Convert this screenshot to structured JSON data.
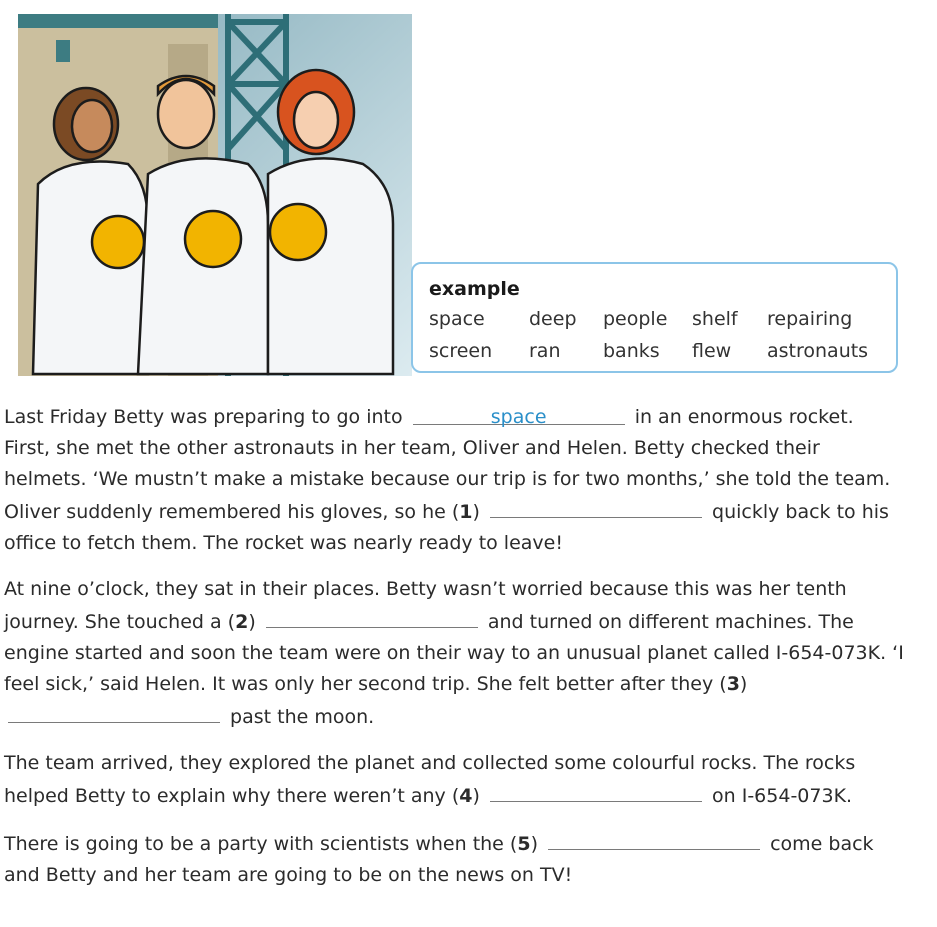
{
  "colors": {
    "box_border": "#8cc5e8",
    "answer_blue": "#2a8fc9",
    "text": "#2b2b2b"
  },
  "illustration": {
    "description_icon": "three-astronauts-illustration"
  },
  "word_box": {
    "title": "example",
    "row1": [
      "space",
      "deep",
      "people",
      "shelf",
      "repairing"
    ],
    "row2": [
      "screen",
      "ran",
      "banks",
      "flew",
      "astronauts"
    ]
  },
  "passage": {
    "p1": {
      "a": "Last Friday Betty was preparing to go into",
      "example_answer": "space",
      "b": "in an enormous rocket. First, she met the other astronauts in her team, Oliver and Helen. Betty checked their helmets. ‘We mustn’t make a mistake because our trip is for two months,’ she told the team. Oliver suddenly remembered his gloves, so he (",
      "n1": "1",
      "c": ")",
      "d": "quickly back to his office to fetch them. The rocket was nearly ready to leave!"
    },
    "p2": {
      "a": "At nine o’clock, they sat in their places. Betty wasn’t worried because this was her tenth journey. She touched a (",
      "n2": "2",
      "b": ")",
      "c": "and turned on different machines. The engine started and soon the team were on their way to an unusual planet called I-654-073K. ‘I feel sick,’ said Helen. It was only her second trip. She felt better after they",
      "d": "(",
      "n3": "3",
      "e": ")",
      "f": "past the moon."
    },
    "p3": {
      "a": "The team arrived, they explored the planet and collected some colourful rocks. The rocks helped Betty to explain why there weren’t any (",
      "n4": "4",
      "b": ")",
      "c": "on I-654-073K."
    },
    "p4": {
      "a": "There is going to be a party with scientists when the (",
      "n5": "5",
      "b": ")",
      "c": "come back and Betty and her team are going to be on the news on TV!"
    }
  }
}
